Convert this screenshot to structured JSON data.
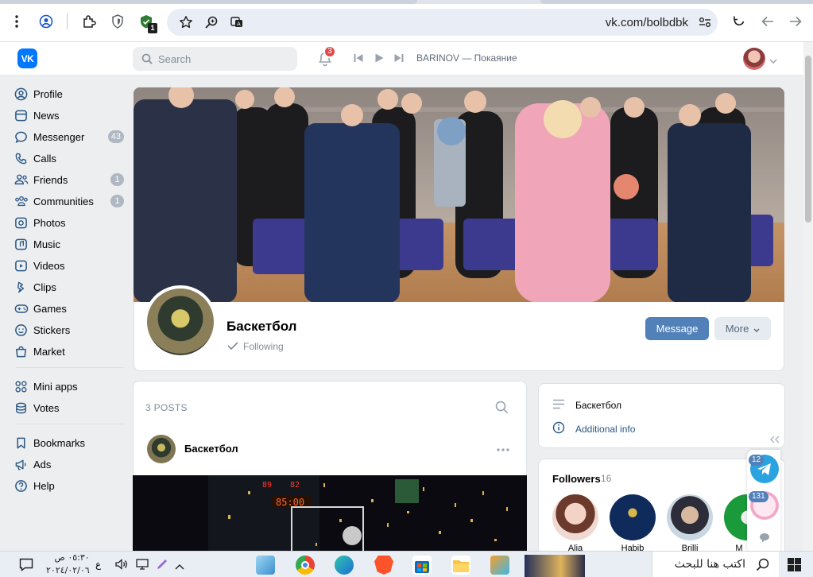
{
  "browser": {
    "url": "vk.com/bolbdbk",
    "extension_badge": "1"
  },
  "vk_header": {
    "logo_text": "VK",
    "search_placeholder": "Search",
    "notifications_count": "3",
    "track_title": "BARINOV — Покаяние"
  },
  "sidebar": {
    "items": [
      {
        "label": "Profile",
        "icon": "profile-icon",
        "count": ""
      },
      {
        "label": "News",
        "icon": "news-icon",
        "count": ""
      },
      {
        "label": "Messenger",
        "icon": "messenger-icon",
        "count": "43"
      },
      {
        "label": "Calls",
        "icon": "calls-icon",
        "count": ""
      },
      {
        "label": "Friends",
        "icon": "friends-icon",
        "count": "1"
      },
      {
        "label": "Communities",
        "icon": "communities-icon",
        "count": "1"
      },
      {
        "label": "Photos",
        "icon": "photos-icon",
        "count": ""
      },
      {
        "label": "Music",
        "icon": "music-icon",
        "count": ""
      },
      {
        "label": "Videos",
        "icon": "videos-icon",
        "count": ""
      },
      {
        "label": "Clips",
        "icon": "clips-icon",
        "count": ""
      },
      {
        "label": "Games",
        "icon": "games-icon",
        "count": ""
      },
      {
        "label": "Stickers",
        "icon": "stickers-icon",
        "count": ""
      },
      {
        "label": "Market",
        "icon": "market-icon",
        "count": ""
      }
    ],
    "group2": [
      {
        "label": "Mini apps",
        "icon": "mini-apps-icon"
      },
      {
        "label": "Votes",
        "icon": "votes-icon"
      }
    ],
    "group3": [
      {
        "label": "Bookmarks",
        "icon": "bookmarks-icon"
      },
      {
        "label": "Ads",
        "icon": "ads-icon"
      },
      {
        "label": "Help",
        "icon": "help-icon"
      }
    ]
  },
  "group": {
    "name": "Баскетбол",
    "following_label": "Following",
    "message_button": "Message",
    "more_button": "More"
  },
  "posts": {
    "count_label": "3 POSTS",
    "author": "Баскетбол"
  },
  "info": {
    "description": "Баскетбол",
    "additional_info": "Additional info"
  },
  "followers": {
    "title": "Followers",
    "count": "16",
    "people": [
      {
        "name": "Alia"
      },
      {
        "name": "Habib"
      },
      {
        "name": "Brilli"
      },
      {
        "name": "M"
      }
    ]
  },
  "floating": {
    "telegram_count": "12",
    "other_count": "131"
  },
  "taskbar": {
    "search_placeholder": "اكتب هنا للبحث",
    "time": "٠٥:٣٠ ص",
    "date": "٢٠٢٤/٠٢/٠٦",
    "lang": "ع"
  },
  "colors": {
    "vk_blue": "#0077ff",
    "button_blue": "#5181b8",
    "link_blue": "#2a5885",
    "badge_red": "#e64646"
  }
}
